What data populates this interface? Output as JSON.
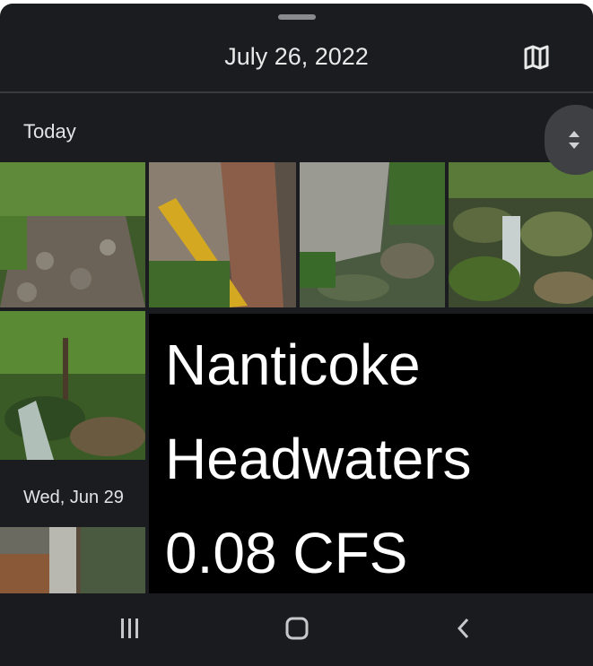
{
  "header": {
    "date": "July 26, 2022",
    "map_icon": "map-icon"
  },
  "sections": [
    {
      "label": "Today"
    },
    {
      "label": "Wed, Jun 29"
    }
  ],
  "overlay": {
    "lines": [
      "Nanticoke",
      "Headwaters",
      "0.08 CFS"
    ]
  },
  "icons": {
    "scroll": "scroll-handle-icon",
    "check": "check-circle-icon",
    "recents": "recent-apps-icon",
    "home": "home-icon",
    "back": "back-icon"
  },
  "colors": {
    "background": "#1b1c1f",
    "text": "#e9e9ea",
    "overlay_bg": "#000000",
    "overlay_text": "#ffffff"
  }
}
